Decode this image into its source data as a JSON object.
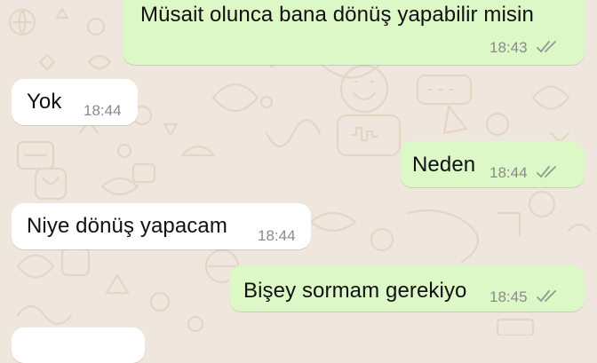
{
  "chat": {
    "messages": [
      {
        "direction": "outgoing",
        "text": "Müsait olunca bana dönüş yapabilir misin",
        "time": "18:43",
        "status": "read-double-check-icon"
      },
      {
        "direction": "incoming",
        "text": "Yok",
        "time": "18:44"
      },
      {
        "direction": "outgoing",
        "text": "Neden",
        "time": "18:44",
        "status": "read-double-check-icon"
      },
      {
        "direction": "incoming",
        "text": "Niye dönüş yapacam",
        "time": "18:44"
      },
      {
        "direction": "outgoing",
        "text": "Bişey sormam gerekiyo",
        "time": "18:45",
        "status": "read-double-check-icon"
      }
    ]
  },
  "colors": {
    "background": "#efe7dd",
    "outgoing_bubble": "#dcf8c6",
    "incoming_bubble": "#ffffff",
    "timestamp": "#8a8a8a",
    "ticks": "#8f9a90"
  }
}
